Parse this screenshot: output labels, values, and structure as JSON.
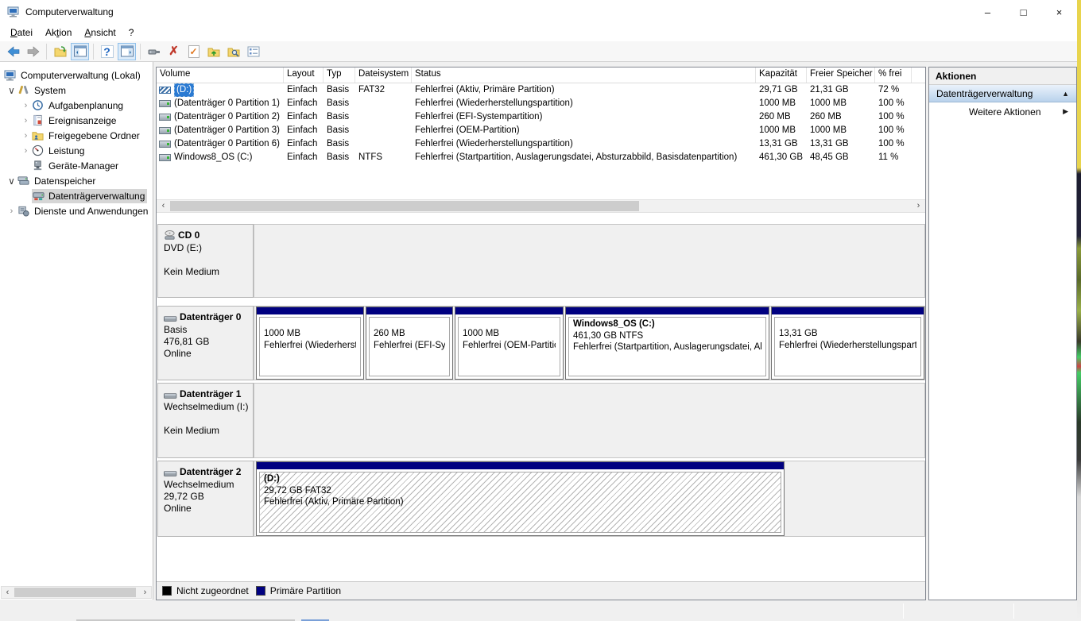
{
  "window": {
    "title": "Computerverwaltung",
    "minimize_glyph": "–",
    "maximize_glyph": "□",
    "close_glyph": "×"
  },
  "menu": {
    "items": [
      {
        "pre": "",
        "key": "D",
        "post": "atei"
      },
      {
        "pre": "Ak",
        "key": "t",
        "post": "ion"
      },
      {
        "pre": "",
        "key": "A",
        "post": "nsicht"
      },
      {
        "pre": "",
        "key": "",
        "post": "?"
      }
    ]
  },
  "toolbar": {
    "icons": [
      "back",
      "forward",
      "export-list",
      "show-console-tree",
      "help",
      "show-action-pane",
      "remote-device",
      "delete",
      "check",
      "folder-up",
      "folder-search",
      "properties"
    ],
    "help_glyph": "?",
    "delete_glyph": "✗",
    "check_glyph": "✓"
  },
  "scroll": {
    "left_glyph": "‹",
    "right_glyph": "›"
  },
  "tree": {
    "items": [
      {
        "label": "Computerverwaltung (Lokal)",
        "chevron": ""
      },
      {
        "label": "System",
        "chevron": "∨"
      },
      {
        "label": "Aufgabenplanung",
        "chevron": "›"
      },
      {
        "label": "Ereignisanzeige",
        "chevron": "›"
      },
      {
        "label": "Freigegebene Ordner",
        "chevron": "›"
      },
      {
        "label": "Leistung",
        "chevron": "›"
      },
      {
        "label": "Geräte-Manager",
        "chevron": ""
      },
      {
        "label": "Datenspeicher",
        "chevron": "∨"
      },
      {
        "label": "Datenträgerverwaltung",
        "chevron": ""
      },
      {
        "label": "Dienste und Anwendungen",
        "chevron": "›"
      }
    ]
  },
  "volume_table": {
    "columns": [
      "Volume",
      "Layout",
      "Typ",
      "Dateisystem",
      "Status",
      "Kapazität",
      "Freier Speicher",
      "% frei"
    ],
    "rows": [
      {
        "volume": "(D:)",
        "layout": "Einfach",
        "typ": "Basis",
        "fs": "FAT32",
        "status": "Fehlerfrei (Aktiv, Primäre Partition)",
        "capacity": "29,71 GB",
        "free": "21,31 GB",
        "pct": "72 %"
      },
      {
        "volume": "(Datenträger 0 Partition 1)",
        "layout": "Einfach",
        "typ": "Basis",
        "fs": "",
        "status": "Fehlerfrei (Wiederherstellungspartition)",
        "capacity": "1000 MB",
        "free": "1000 MB",
        "pct": "100 %"
      },
      {
        "volume": "(Datenträger 0 Partition 2)",
        "layout": "Einfach",
        "typ": "Basis",
        "fs": "",
        "status": "Fehlerfrei (EFI-Systempartition)",
        "capacity": "260 MB",
        "free": "260 MB",
        "pct": "100 %"
      },
      {
        "volume": "(Datenträger 0 Partition 3)",
        "layout": "Einfach",
        "typ": "Basis",
        "fs": "",
        "status": "Fehlerfrei (OEM-Partition)",
        "capacity": "1000 MB",
        "free": "1000 MB",
        "pct": "100 %"
      },
      {
        "volume": "(Datenträger 0 Partition 6)",
        "layout": "Einfach",
        "typ": "Basis",
        "fs": "",
        "status": "Fehlerfrei (Wiederherstellungspartition)",
        "capacity": "13,31 GB",
        "free": "13,31 GB",
        "pct": "100 %"
      },
      {
        "volume": "Windows8_OS (C:)",
        "layout": "Einfach",
        "typ": "Basis",
        "fs": "NTFS",
        "status": "Fehlerfrei (Startpartition, Auslagerungsdatei, Absturzabbild, Basisdatenpartition)",
        "capacity": "461,30 GB",
        "free": "48,45 GB",
        "pct": "11 %"
      }
    ]
  },
  "disks": [
    {
      "name": "CD 0",
      "line1": "DVD (E:)",
      "line2": "",
      "line3": "Kein Medium"
    },
    {
      "name": "Datenträger 0",
      "line1": "Basis",
      "line2": "476,81 GB",
      "line3": "Online",
      "partitions": [
        {
          "name": "",
          "size": "1000 MB",
          "status": "Fehlerfrei (Wiederherstellungspartition)"
        },
        {
          "name": "",
          "size": "260 MB",
          "status": "Fehlerfrei (EFI-Systempartition)"
        },
        {
          "name": "",
          "size": "1000 MB",
          "status": "Fehlerfrei (OEM-Partition)"
        },
        {
          "name": "Windows8_OS  (C:)",
          "size": "461,30 GB NTFS",
          "status": "Fehlerfrei (Startpartition, Auslagerungsdatei, Absturzabbild, Basisdatenpartition)"
        },
        {
          "name": "",
          "size": "13,31 GB",
          "status": "Fehlerfrei (Wiederherstellungspartition)"
        }
      ]
    },
    {
      "name": "Datenträger 1",
      "line1": "Wechselmedium (I:)",
      "line2": "",
      "line3": "Kein Medium"
    },
    {
      "name": "Datenträger 2",
      "line1": "Wechselmedium",
      "line2": "29,72 GB",
      "line3": "Online",
      "partitions": [
        {
          "name": "(D:)",
          "size": "29,72 GB FAT32",
          "status": "Fehlerfrei (Aktiv, Primäre Partition)"
        }
      ]
    }
  ],
  "legend": {
    "items": [
      {
        "label": "Nicht zugeordnet",
        "color": "#000000"
      },
      {
        "label": "Primäre Partition",
        "color": "#000080"
      }
    ]
  },
  "actions": {
    "header": "Aktionen",
    "group": "Datenträgerverwaltung",
    "group_arrow": "▲",
    "item": "Weitere Aktionen",
    "item_arrow": "▶"
  },
  "colors": {
    "primary_partition": "#000080",
    "selection_blue": "#2a7ad2"
  }
}
